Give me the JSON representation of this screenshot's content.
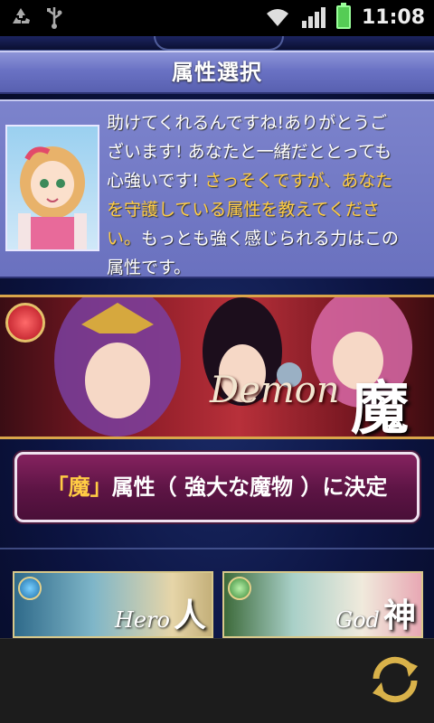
{
  "status_bar": {
    "time": "11:08",
    "icons": [
      "recycle-icon",
      "usb-icon",
      "wifi-icon",
      "signal-icon",
      "battery-charging-icon"
    ]
  },
  "screen": {
    "title": "属性選択"
  },
  "dialog": {
    "line1": "助けてくれるんですね!ありがとうご",
    "line2": "ざいます! あなたと一緒だととっても",
    "line3_plain": "心強いです! ",
    "line3_highlight": "さっそくですが、あなた",
    "line4_highlight": "を守護している属性を教えてくださ",
    "line5_highlight": "い。",
    "line5_plain": "もっとも強く感じられる力はこの",
    "line6": "属性です。"
  },
  "featured_attribute": {
    "word": "Demon",
    "kanji": "魔"
  },
  "decide_button": {
    "quoted": "「魔」",
    "rest": "属性（ 強大な魔物 ）に決定"
  },
  "other_attributes": [
    {
      "word": "Hero",
      "kanji": "人"
    },
    {
      "word": "God",
      "kanji": "神"
    }
  ],
  "colors": {
    "title_bar": "#6a72c4",
    "highlight_text": "#ffcc44",
    "decide_button": "#5c1444",
    "frame_gold": "#d9a54a"
  }
}
